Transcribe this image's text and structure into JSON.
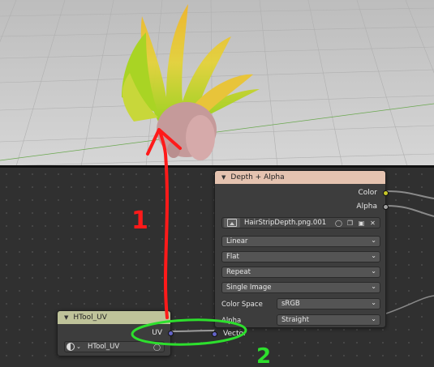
{
  "viewport": {
    "description_icon": "3d-hair-model"
  },
  "annotations": {
    "step1": "1",
    "step2": "2",
    "arrow_color": "#ff0000",
    "circle_color": "#22dd22"
  },
  "depth_node": {
    "title": "Depth + Alpha",
    "header_color": "#e5c3b0",
    "outputs": [
      {
        "label": "Color",
        "color": "#c7c729"
      },
      {
        "label": "Alpha",
        "color": "#a1a1a1"
      }
    ],
    "image_name": "HairStripDepth.png.001",
    "interpolation": "Linear",
    "projection": "Flat",
    "extension": "Repeat",
    "source": "Single Image",
    "color_space_label": "Color Space",
    "color_space_value": "sRGB",
    "alpha_label": "Alpha",
    "alpha_value": "Straight",
    "input_label": "Vector",
    "input_color": "#6363c7"
  },
  "uv_node": {
    "title": "HTool_UV",
    "header_color": "#bfc39a",
    "output_label": "UV",
    "output_color": "#6363c7",
    "map_name": "HTool_UV"
  }
}
